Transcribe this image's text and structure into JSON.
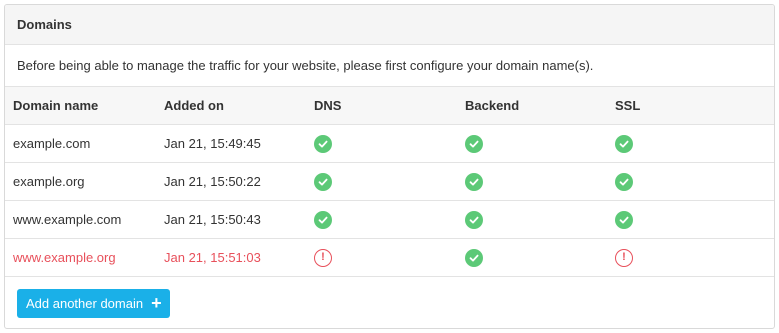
{
  "panel": {
    "title": "Domains",
    "intro": "Before being able to manage the traffic for your website, please first configure your domain name(s)."
  },
  "table": {
    "columns": [
      "Domain name",
      "Added on",
      "DNS",
      "Backend",
      "SSL"
    ],
    "rows": [
      {
        "domain": "example.com",
        "added": "Jan 21, 15:49:45",
        "dns": "ok",
        "backend": "ok",
        "ssl": "ok",
        "status": "ok"
      },
      {
        "domain": "example.org",
        "added": "Jan 21, 15:50:22",
        "dns": "ok",
        "backend": "ok",
        "ssl": "ok",
        "status": "ok"
      },
      {
        "domain": "www.example.com",
        "added": "Jan 21, 15:50:43",
        "dns": "ok",
        "backend": "ok",
        "ssl": "ok",
        "status": "ok"
      },
      {
        "domain": "www.example.org",
        "added": "Jan 21, 15:51:03",
        "dns": "error",
        "backend": "ok",
        "ssl": "error",
        "status": "error"
      }
    ]
  },
  "actions": {
    "add_label": "Add another domain",
    "add_icon": "plus-icon"
  },
  "colors": {
    "ok": "#5cc977",
    "error": "#e8505b",
    "primary": "#1ab0e8"
  }
}
